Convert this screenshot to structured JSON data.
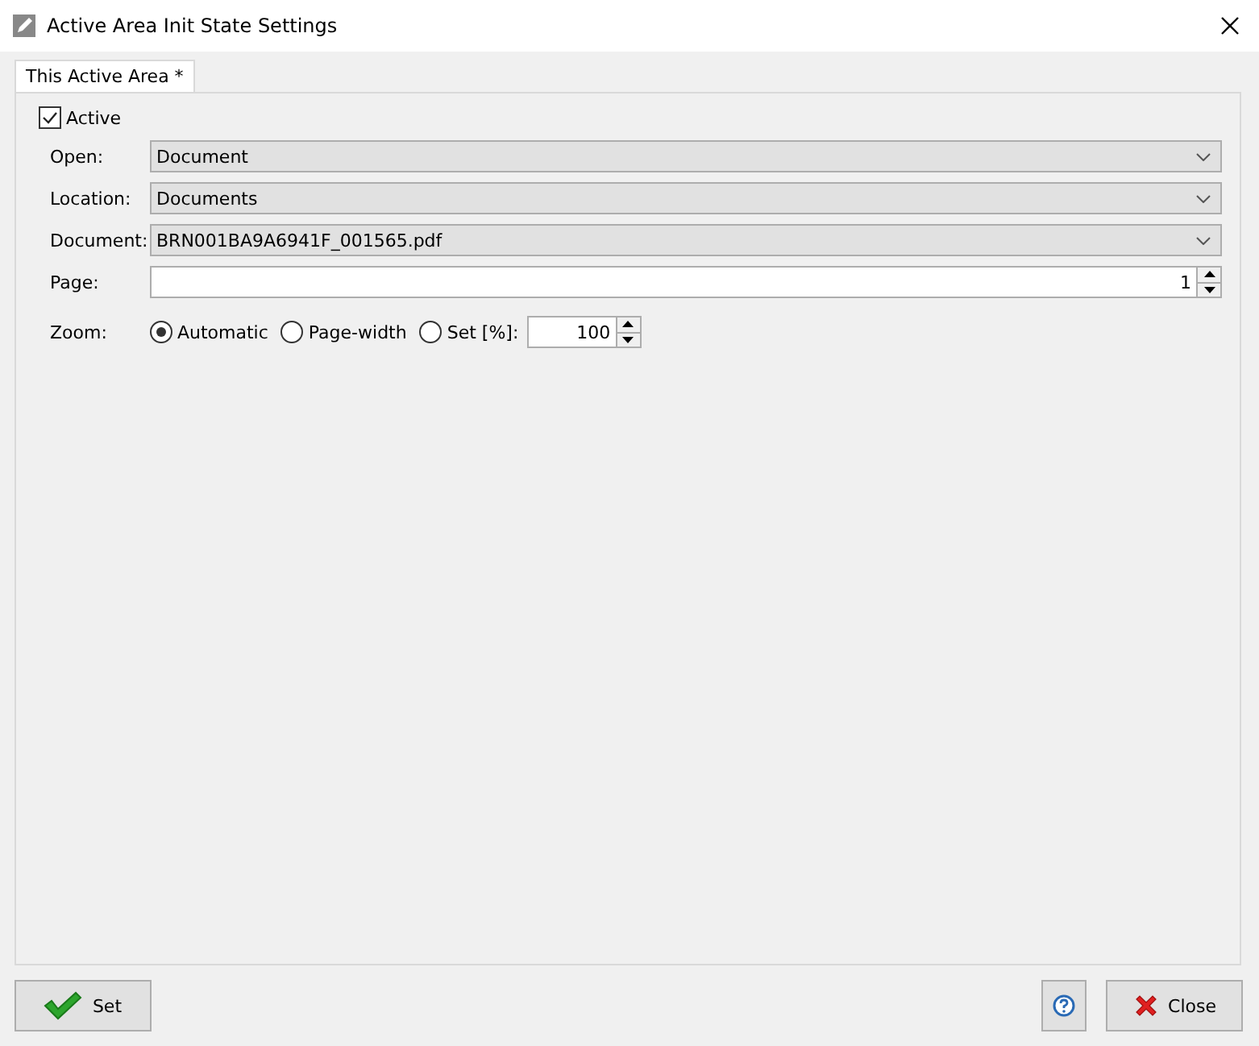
{
  "window": {
    "title": "Active Area Init State Settings"
  },
  "tabs": [
    {
      "label": "This Active Area *",
      "selected": true
    }
  ],
  "active": {
    "label": "Active",
    "checked": true
  },
  "fields": [
    {
      "kind": "select",
      "label": "Open:",
      "value": "Document"
    },
    {
      "kind": "select",
      "label": "Location:",
      "value": "Documents"
    },
    {
      "kind": "select",
      "label": "Document:",
      "value": "BRN001BA9A6941F_001565.pdf"
    },
    {
      "kind": "spin",
      "label": "Page:",
      "value": "1"
    }
  ],
  "zoom": {
    "label": "Zoom:",
    "options": [
      {
        "label": "Automatic",
        "selected": true
      },
      {
        "label": "Page-width",
        "selected": false
      },
      {
        "label": "Set [%]:",
        "selected": false
      }
    ],
    "value": "100"
  },
  "buttons": [
    {
      "kind": "set",
      "label": "Set"
    },
    {
      "kind": "help"
    },
    {
      "kind": "close",
      "label": "Close"
    }
  ]
}
